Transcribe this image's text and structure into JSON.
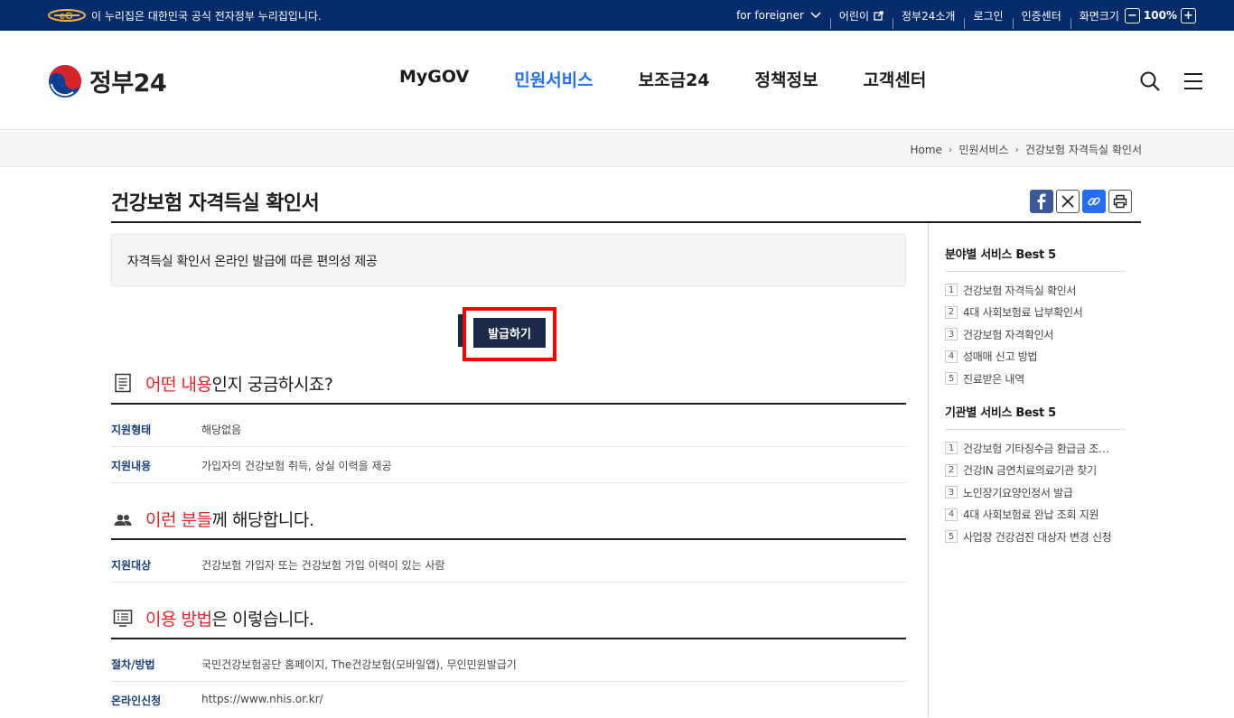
{
  "topbar": {
    "notice": "이 누리집은 대한민국 공식 전자정부 누리집입니다.",
    "links": [
      "for foreigner",
      "어린이",
      "정부24소개",
      "로그인",
      "인증센터",
      "화면크기"
    ],
    "zoom": "100%",
    "zoom_minus": "−",
    "zoom_plus": "+"
  },
  "header": {
    "brand": "정부24",
    "nav": [
      "MyGOV",
      "민원서비스",
      "보조금24",
      "정책정보",
      "고객센터"
    ],
    "active_nav": "민원서비스"
  },
  "breadcrumb": [
    "Home",
    "민원서비스",
    "건강보험 자격득실 확인서"
  ],
  "page": {
    "title": "건강보험 자격득실 확인서",
    "summary": "자격득실 확인서 온라인 발급에 따른 편의성 제공",
    "issue_button": "발급하기"
  },
  "sections": [
    {
      "title_highlight": "어떤 내용",
      "title_rest": "인지 궁금하시죠?",
      "icon": "document-icon",
      "rows": [
        {
          "label": "지원형태",
          "value": "해당없음"
        },
        {
          "label": "지원내용",
          "value": "가입자의 건강보험 취득, 상실 이력을 제공"
        }
      ]
    },
    {
      "title_highlight": "이런 분들",
      "title_rest": "께 해당합니다.",
      "icon": "people-icon",
      "rows": [
        {
          "label": "지원대상",
          "value": "건강보험 가입자 또는 건강보험 가입 이력이 있는 사람"
        }
      ]
    },
    {
      "title_highlight": "이용 방법",
      "title_rest": "은 이렇습니다.",
      "icon": "list-icon",
      "rows": [
        {
          "label": "절차/방법",
          "value": "국민건강보험공단 홈페이지, The건강보험(모바일앱), 무인민원발급기"
        },
        {
          "label": "온라인신청",
          "value": "https://www.nhis.or.kr/"
        }
      ]
    }
  ],
  "sidebar": {
    "field_best": {
      "title": "분야별 서비스 Best 5",
      "items": [
        "건강보험 자격득실 확인서",
        "4대 사회보험료 납부확인서",
        "건강보험 자격확인서",
        "성매매 신고 방법",
        "진료받은 내역"
      ]
    },
    "agency_best": {
      "title": "기관별 서비스 Best 5",
      "items": [
        "건강보험 기타징수금 환급금 조…",
        "건강IN 금연치료의료기관 찾기",
        "노인장기요양인정서 발급",
        "4대 사회보험료 완납 조회 지원",
        "사업장 건강검진 대상자 변경 신청"
      ]
    }
  },
  "colors": {
    "topbar_bg": "#052b6b",
    "active_nav": "#256ef4",
    "highlight": "#e0252b",
    "button_bg": "#1b2b47",
    "focus_outline": "#ff0000"
  }
}
